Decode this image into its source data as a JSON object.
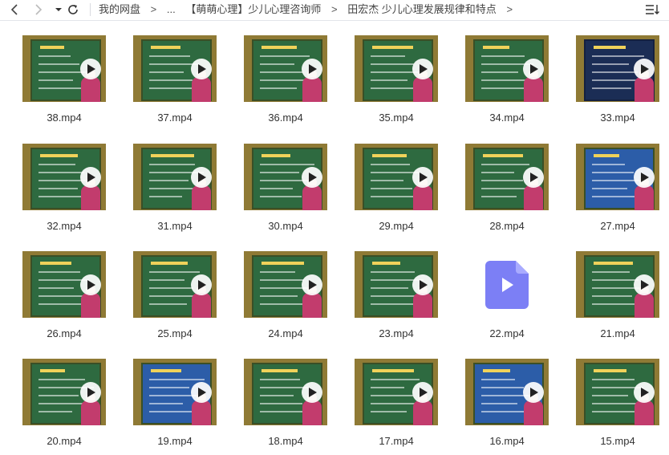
{
  "toolbar": {
    "breadcrumbs": [
      "我的网盘",
      "...",
      "【萌萌心理】少儿心理咨询师",
      "田宏杰 少儿心理发展规律和特点"
    ],
    "separator": ">"
  },
  "files": [
    {
      "name": "38.mp4",
      "type": "video"
    },
    {
      "name": "37.mp4",
      "type": "video"
    },
    {
      "name": "36.mp4",
      "type": "video"
    },
    {
      "name": "35.mp4",
      "type": "video"
    },
    {
      "name": "34.mp4",
      "type": "video"
    },
    {
      "name": "33.mp4",
      "type": "video"
    },
    {
      "name": "32.mp4",
      "type": "video"
    },
    {
      "name": "31.mp4",
      "type": "video"
    },
    {
      "name": "30.mp4",
      "type": "video"
    },
    {
      "name": "29.mp4",
      "type": "video"
    },
    {
      "name": "28.mp4",
      "type": "video"
    },
    {
      "name": "27.mp4",
      "type": "video"
    },
    {
      "name": "26.mp4",
      "type": "video"
    },
    {
      "name": "25.mp4",
      "type": "video"
    },
    {
      "name": "24.mp4",
      "type": "video"
    },
    {
      "name": "23.mp4",
      "type": "video"
    },
    {
      "name": "22.mp4",
      "type": "video-placeholder"
    },
    {
      "name": "21.mp4",
      "type": "video"
    },
    {
      "name": "20.mp4",
      "type": "video"
    },
    {
      "name": "19.mp4",
      "type": "video"
    },
    {
      "name": "18.mp4",
      "type": "video"
    },
    {
      "name": "17.mp4",
      "type": "video"
    },
    {
      "name": "16.mp4",
      "type": "video"
    },
    {
      "name": "15.mp4",
      "type": "video"
    }
  ],
  "colors": {
    "play_accent": "#7c7ff5",
    "text": "#333333",
    "board": "#2e6a40"
  }
}
